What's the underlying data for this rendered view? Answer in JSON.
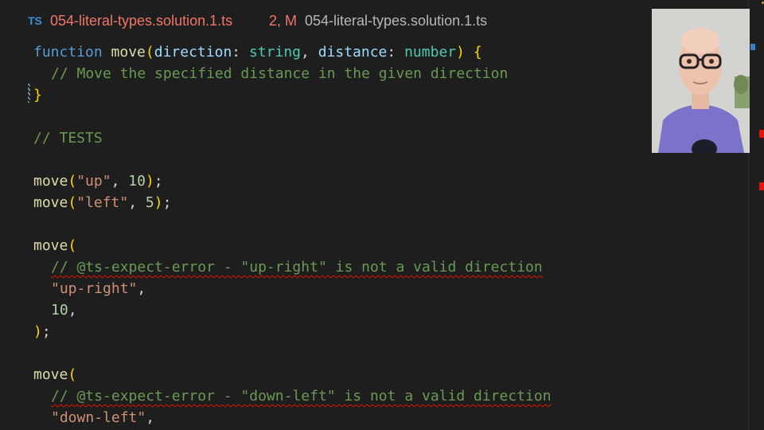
{
  "tab": {
    "lang_badge": "TS",
    "file_name": "054-literal-types.solution.1.ts",
    "status": "2, M",
    "breadcrumb": "054-literal-types.solution.1.ts"
  },
  "code": {
    "l1": {
      "kw": "function",
      "name": "move",
      "open": "(",
      "p1": "direction",
      "colon1": ": ",
      "t1": "string",
      "comma": ", ",
      "p2": "distance",
      "colon2": ": ",
      "t2": "number",
      "close": ")",
      "brace": "{"
    },
    "l2": "// Move the specified distance in the given direction",
    "l3": "}",
    "l5": "// TESTS",
    "l7": {
      "fn": "move",
      "open": "(",
      "arg1": "\"up\"",
      "comma": ", ",
      "arg2": "10",
      "close": ")",
      "semi": ";"
    },
    "l8": {
      "fn": "move",
      "open": "(",
      "arg1": "\"left\"",
      "comma": ", ",
      "arg2": "5",
      "close": ")",
      "semi": ";"
    },
    "l10": {
      "fn": "move",
      "open": "("
    },
    "l11": "// @ts-expect-error - \"up-right\" is not a valid direction",
    "l12": {
      "str": "\"up-right\"",
      "comma": ","
    },
    "l13": {
      "num": "10",
      "comma": ","
    },
    "l14": {
      "close": ")",
      "semi": ";"
    },
    "l16": {
      "fn": "move",
      "open": "("
    },
    "l17": "// @ts-expect-error - \"down-left\" is not a valid direction",
    "l18": {
      "str": "\"down-left\"",
      "comma": ","
    }
  },
  "colors": {
    "background": "#1e1e1e",
    "keyword": "#569cd6",
    "function": "#dcdcaa",
    "parameter": "#9cdcfe",
    "type": "#4ec9b0",
    "string": "#ce9178",
    "number": "#b5cea8",
    "comment": "#6a9955",
    "bracket": "#ffd700",
    "error": "#e51400",
    "modified_tab": "#f0766a"
  }
}
